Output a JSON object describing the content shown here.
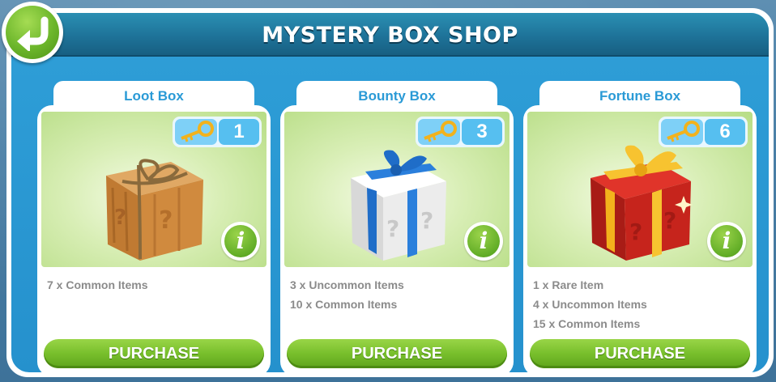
{
  "header": {
    "title": "MYSTERY BOX SHOP"
  },
  "boxes": [
    {
      "name": "Loot Box",
      "price": "1",
      "icon": "loot-box-icon",
      "contents": [
        "7 x Common Items"
      ],
      "purchase_label": "PURCHASE"
    },
    {
      "name": "Bounty Box",
      "price": "3",
      "icon": "bounty-box-icon",
      "contents": [
        "3 x Uncommon Items",
        "10 x Common Items"
      ],
      "purchase_label": "PURCHASE"
    },
    {
      "name": "Fortune Box",
      "price": "6",
      "icon": "fortune-box-icon",
      "contents": [
        "1 x Rare Item",
        "4 x Uncommon Items",
        "15 x Common Items"
      ],
      "purchase_label": "PURCHASE"
    }
  ],
  "colors": {
    "accent": "#2a9ad6",
    "button_green": "#78bf2c",
    "header": "#1e7399"
  },
  "icons": {
    "back": "back-arrow-icon",
    "currency": "key-icon",
    "info": "info-icon"
  }
}
